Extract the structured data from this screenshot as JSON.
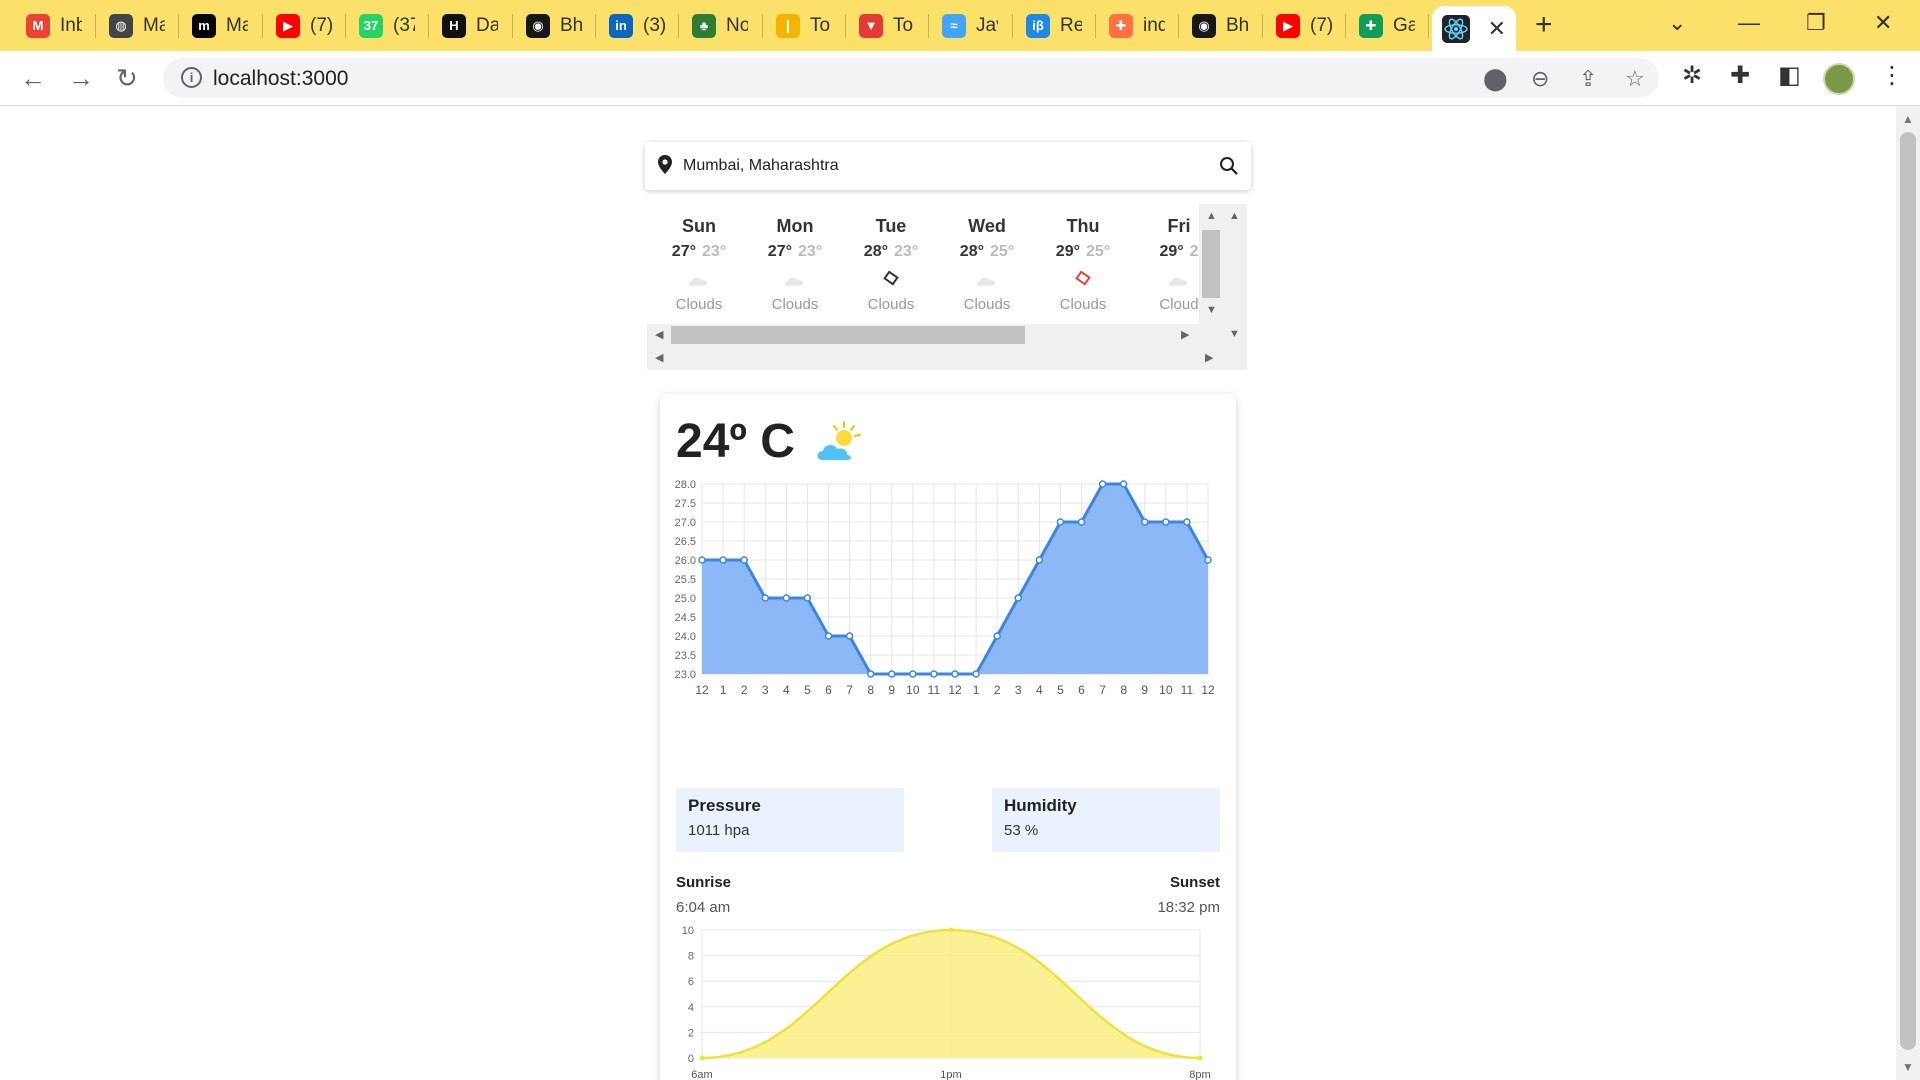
{
  "browser": {
    "tabs": [
      {
        "label": "Inb",
        "icon": "gmail-icon",
        "color": "#ea4335",
        "glyph": "M"
      },
      {
        "label": "Ma",
        "icon": "globe-icon",
        "color": "#444444",
        "glyph": "◍"
      },
      {
        "label": "Ma",
        "icon": "medium-icon",
        "color": "#000000",
        "glyph": "m"
      },
      {
        "label": "(7)",
        "icon": "youtube-icon",
        "color": "#ff0000",
        "glyph": "▶"
      },
      {
        "label": "(37",
        "icon": "whatsapp-icon",
        "color": "#25d366",
        "glyph": "37"
      },
      {
        "label": "Da",
        "icon": "hackerrank-icon",
        "color": "#111111",
        "glyph": "H"
      },
      {
        "label": "Bh",
        "icon": "github-icon",
        "color": "#181717",
        "glyph": "◉"
      },
      {
        "label": "(3)",
        "icon": "linkedin-icon",
        "color": "#0a66c2",
        "glyph": "in"
      },
      {
        "label": "No",
        "icon": "tree-icon",
        "color": "#2e7d32",
        "glyph": "♣"
      },
      {
        "label": "To",
        "icon": "bookmark-icon",
        "color": "#f4b400",
        "glyph": "❙"
      },
      {
        "label": "To",
        "icon": "vercel-icon",
        "color": "#e53935",
        "glyph": "▼"
      },
      {
        "label": "Jav",
        "icon": "ship-icon",
        "color": "#42a5f5",
        "glyph": "≈"
      },
      {
        "label": "Re",
        "icon": "beta-icon",
        "color": "#1e88e5",
        "glyph": "iβ"
      },
      {
        "label": "ind",
        "icon": "puzzle-orange-icon",
        "color": "#ff7043",
        "glyph": "✚"
      },
      {
        "label": "Bh",
        "icon": "github-icon",
        "color": "#181717",
        "glyph": "◉"
      },
      {
        "label": "(7)",
        "icon": "youtube-icon",
        "color": "#ff0000",
        "glyph": "▶"
      },
      {
        "label": "Ga",
        "icon": "sheets-icon",
        "color": "#0f9d58",
        "glyph": "✚"
      }
    ],
    "active_tab_icon": "react-icon",
    "url": "localhost:3000"
  },
  "search": {
    "value": "Mumbai, Maharashtra"
  },
  "forecast": [
    {
      "day": "Sun",
      "high": "27°",
      "low": "23°",
      "condition": "Clouds",
      "icon": "cloud-icon"
    },
    {
      "day": "Mon",
      "high": "27°",
      "low": "23°",
      "condition": "Clouds",
      "icon": "cloud-icon"
    },
    {
      "day": "Tue",
      "high": "28°",
      "low": "23°",
      "condition": "Clouds",
      "icon": "broken-image-icon"
    },
    {
      "day": "Wed",
      "high": "28°",
      "low": "25°",
      "condition": "Clouds",
      "icon": "cloud-icon"
    },
    {
      "day": "Thu",
      "high": "29°",
      "low": "25°",
      "condition": "Clouds",
      "icon": "broken-image-red-icon"
    },
    {
      "day": "Fri",
      "high": "29°",
      "low": "2",
      "condition": "Cloud",
      "icon": "cloud-icon"
    }
  ],
  "current": {
    "temperature": "24º C",
    "icon": "partly-sunny-icon"
  },
  "chart_data": [
    {
      "type": "area",
      "categories": [
        "12",
        "1",
        "2",
        "3",
        "4",
        "5",
        "6",
        "7",
        "8",
        "9",
        "10",
        "11",
        "12",
        "1",
        "2",
        "3",
        "4",
        "5",
        "6",
        "7",
        "8",
        "9",
        "10",
        "11",
        "12"
      ],
      "values": [
        26,
        26,
        26,
        25,
        25,
        25,
        24,
        24,
        23,
        23,
        23,
        23,
        23,
        23,
        24,
        25,
        26,
        27,
        27,
        28,
        28,
        27,
        27,
        27,
        26
      ],
      "y_ticks": [
        "28.0",
        "27.5",
        "27.0",
        "26.5",
        "26.0",
        "25.5",
        "25.0",
        "24.5",
        "24.0",
        "23.5",
        "23.0"
      ],
      "ylim": [
        23,
        28
      ],
      "grid": true,
      "color": "#3a86e0",
      "fill": "#8cb8f7"
    },
    {
      "type": "area",
      "categories": [
        "6am",
        "1pm",
        "8pm"
      ],
      "x": [
        6,
        13,
        20
      ],
      "values": [
        0,
        10,
        0
      ],
      "y_ticks": [
        "10",
        "8",
        "6",
        "4",
        "2",
        "0"
      ],
      "ylim": [
        0,
        10
      ],
      "grid": true,
      "color": "#f2df3a",
      "fill": "#faf08a"
    }
  ],
  "pressure": {
    "label": "Pressure",
    "value": "1011 hpa"
  },
  "humidity": {
    "label": "Humidity",
    "value": "53 %"
  },
  "sunrise": {
    "label": "Sunrise",
    "value": "6:04 am"
  },
  "sunset": {
    "label": "Sunset",
    "value": "18:32 pm"
  }
}
